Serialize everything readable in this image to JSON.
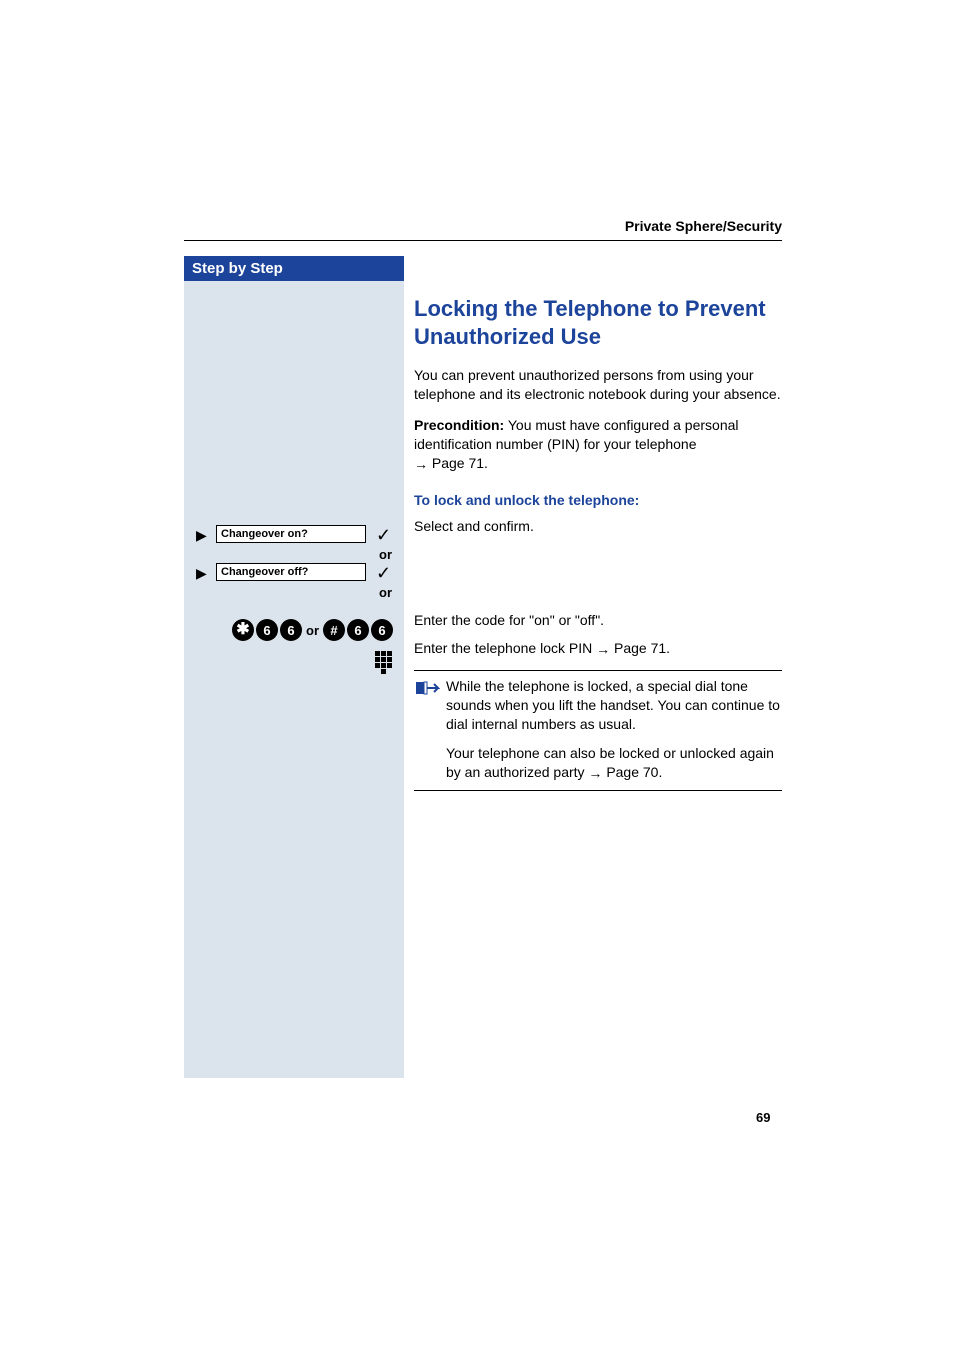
{
  "header": {
    "section_title": "Private Sphere/Security"
  },
  "sidebar": {
    "title": "Step by Step",
    "display1": "Changeover on?",
    "display2": "Changeover off?",
    "or1": "or",
    "or2": "or",
    "keys": {
      "star": "✱",
      "hash": "#",
      "six": "6",
      "or": "or"
    }
  },
  "content": {
    "heading": "Locking the Telephone to Prevent Unauthorized Use",
    "intro": "You can prevent unauthorized persons from using your telephone and its electronic notebook during your absence.",
    "precond_label": "Precondition:",
    "precond_text": " You must have configured a personal identification number (PIN) for your telephone ",
    "precond_ref": "Page 71.",
    "sub": "To lock and unlock the telephone:",
    "select": "Select and confirm.",
    "enter_code": "Enter the code for \"on\" or \"off\".",
    "enter_pin_a": "Enter the telephone lock PIN ",
    "enter_pin_ref": "Page 71.",
    "note1": "While the telephone is locked, a special dial tone sounds when you lift the handset. You can continue to dial internal numbers as usual.",
    "note2_a": "Your telephone can also be locked or unlocked again by an authorized party ",
    "note2_ref": "Page 70."
  },
  "page_number": "69"
}
